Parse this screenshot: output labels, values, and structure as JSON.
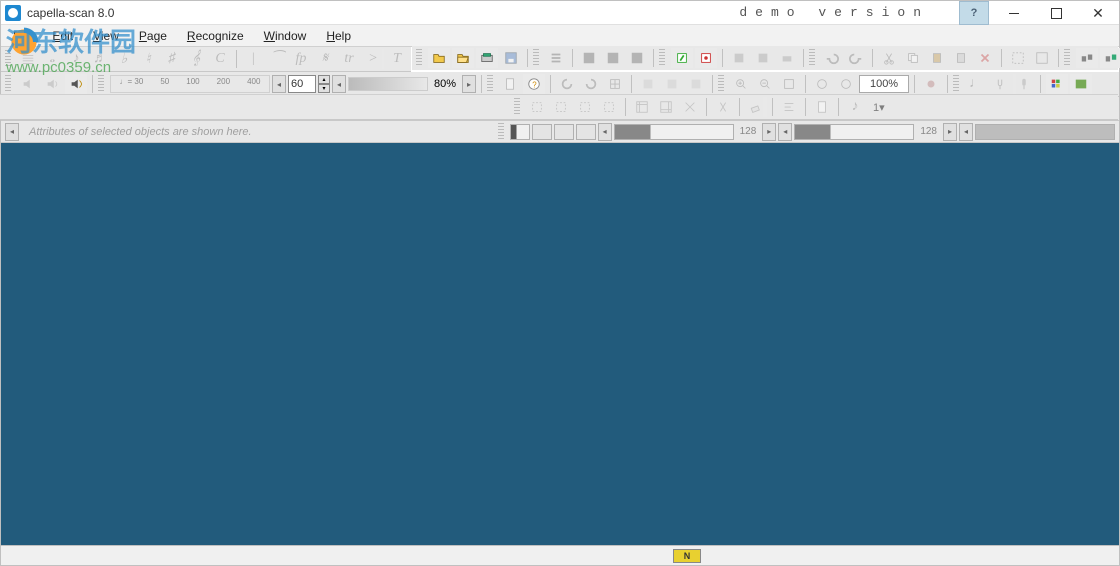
{
  "title": "capella-scan 8.0",
  "demo_label": "demo version",
  "menu": {
    "file": "File",
    "edit": "Edit",
    "view": "View",
    "page": "Page",
    "recognize": "Recognize",
    "window": "Window",
    "help": "Help"
  },
  "zoom": "100%",
  "tempo_box": "60",
  "volume_pct": "80%",
  "ruler_marks": [
    "♩= 30",
    "50",
    "100",
    "200",
    "400"
  ],
  "attributes_hint": "Attributes of selected objects are shown here.",
  "slider_a": "128",
  "slider_b": "128",
  "status_badge": "N",
  "dyn_glyphs": {
    "fp": "fp",
    "trill": "tr",
    "arrow": ">",
    "text": "T",
    "sharp": "♯",
    "pitch": "1▾"
  },
  "watermark": {
    "cn": "河东软件园",
    "url": "www.pc0359.cn"
  }
}
